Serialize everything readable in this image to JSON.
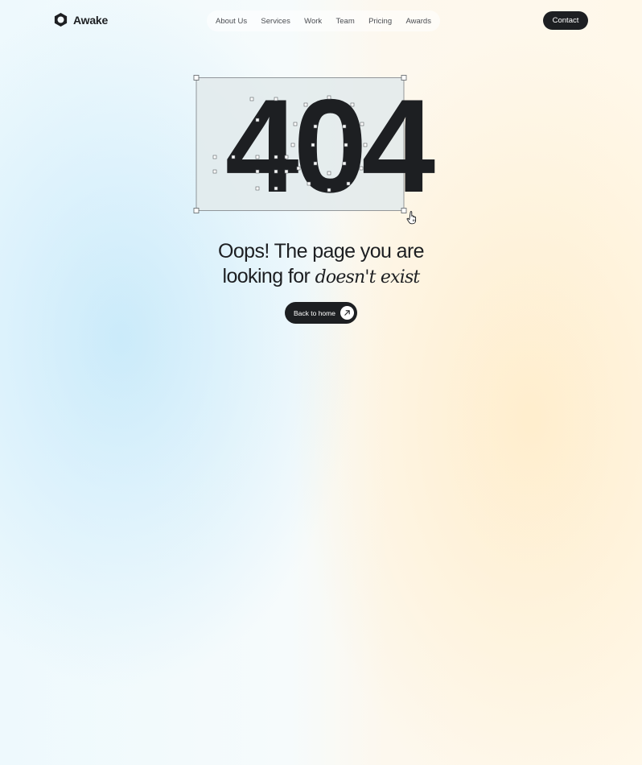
{
  "brand": {
    "name": "Awake",
    "logo_icon": "hexagon-ring-icon"
  },
  "nav": {
    "items": [
      {
        "label": "About Us"
      },
      {
        "label": "Services"
      },
      {
        "label": "Work"
      },
      {
        "label": "Team"
      },
      {
        "label": "Pricing"
      },
      {
        "label": "Awards"
      }
    ]
  },
  "header": {
    "contact_label": "Contact"
  },
  "error": {
    "code": "404",
    "headline_line1": "Oops! The page you are",
    "headline_line2_regular": "looking for ",
    "headline_line2_italic": "doesn't exist",
    "back_button_label": "Back to home",
    "back_button_icon": "arrow-up-right-icon"
  },
  "colors": {
    "primary": "#1d1f22",
    "selection_fill": "#e2eaeb",
    "selection_stroke": "#7c8185"
  }
}
